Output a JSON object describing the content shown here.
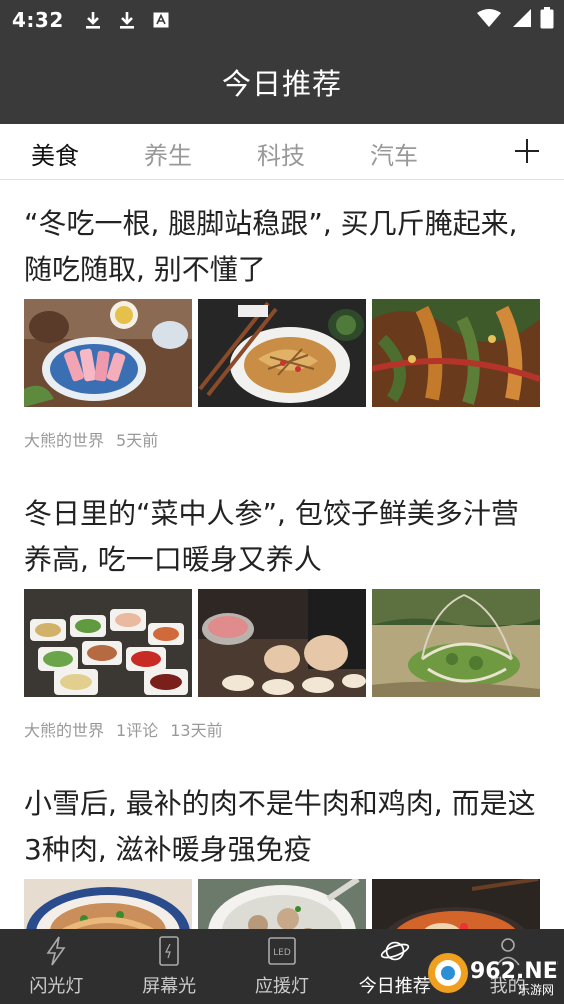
{
  "status": {
    "time": "4:32"
  },
  "appbar": {
    "title": "今日推荐"
  },
  "tabs": [
    {
      "label": "美食",
      "active": true
    },
    {
      "label": "养生"
    },
    {
      "label": "科技"
    },
    {
      "label": "汽车"
    }
  ],
  "articles": [
    {
      "title": "“冬吃一根, 腿脚站稳跟”, 买几斤腌起来, 随吃随取, 别不懂了",
      "source": "大熊的世界",
      "comments": "",
      "time": "5天前"
    },
    {
      "title": "冬日里的“菜中人参”, 包饺子鲜美多汁营养高, 吃一口暖身又养人",
      "source": "大熊的世界",
      "comments": "1评论",
      "time": "13天前"
    },
    {
      "title": "小雪后, 最补的肉不是牛肉和鸡肉, 而是这3种肉, 滋补暖身强免疫",
      "source": "",
      "comments": "",
      "time": ""
    }
  ],
  "bottom_nav": [
    {
      "label": "闪光灯",
      "icon": "flash-icon"
    },
    {
      "label": "屏幕光",
      "icon": "phone-screen-icon"
    },
    {
      "label": "应援灯",
      "icon": "led-icon"
    },
    {
      "label": "今日推荐",
      "icon": "planet-icon",
      "active": true
    },
    {
      "label": "我的",
      "icon": "person-icon"
    }
  ],
  "icons": {
    "led_text": "LED"
  },
  "watermark": {
    "text": "962.NET",
    "subtext": "乐游网"
  }
}
